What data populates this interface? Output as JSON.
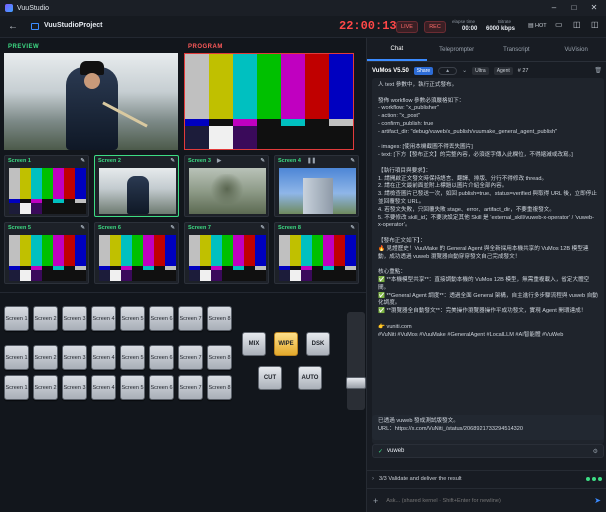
{
  "app": {
    "title": "VuuStudio"
  },
  "topbar": {
    "project": "VuuStudioProject",
    "timecode": "22:00:13",
    "live": "LIVE",
    "rec": "REC",
    "elapsed_label": "elapse time",
    "elapsed": "00:00",
    "bitrate_label": "Bitrate",
    "bitrate": "6000 kbps",
    "hot": "HOT"
  },
  "preview": {
    "label": "PREVIEW"
  },
  "program": {
    "label": "PROGRAM"
  },
  "screens": [
    {
      "label": "Screen 1"
    },
    {
      "label": "Screen 2"
    },
    {
      "label": "Screen 3"
    },
    {
      "label": "Screen 4"
    },
    {
      "label": "Screen 5"
    },
    {
      "label": "Screen 6"
    },
    {
      "label": "Screen 7"
    },
    {
      "label": "Screen 8"
    }
  ],
  "switcher": {
    "rows": [
      [
        "Screen 1",
        "Screen 2",
        "Screen 3",
        "Screen 4",
        "Screen 5",
        "Screen 6",
        "Screen 7",
        "Screen 8"
      ],
      [
        "Screen 1",
        "Screen 2",
        "Screen 3",
        "Screen 4",
        "Screen 5",
        "Screen 6",
        "Screen 7",
        "Screen 8"
      ],
      [
        "Screen 1",
        "Screen 2",
        "Screen 3",
        "Screen 4",
        "Screen 5",
        "Screen 6",
        "Screen 7",
        "Screen 8"
      ]
    ]
  },
  "transitions": {
    "mix": "MIX",
    "wipe": "WIPE",
    "dsk": "DSK",
    "cut": "CUT",
    "auto": "AUTO"
  },
  "colors": {
    "accent": "#3b8bff",
    "green": "#3ddc84",
    "red": "#e23b3b",
    "wipe": "#f2c14e"
  },
  "chat": {
    "tabs": [
      "Chat",
      "Teleprompter",
      "Transcript",
      "VuVision"
    ],
    "version": "VuMos V5.50",
    "share": "Share",
    "model": "Ultra",
    "mode": "Agent",
    "number": "# 27",
    "message": "人 text 參數中，執行正式發布。\n\n發佈 workflow 參數必須嚴格如下：\n- workflow: \"x_publisher\"\n- action: \"x_post\"\n- confirm_publish: true\n- artifact_dir: \"debug/vuweb/x_publish/vuumake_general_agent_publish\"\n\n- images: [使用本機截圖不得丟失圖片]\n- text: [下方【發布正文】的完整內容，必須逐字傳入此欄位，不得縮減或改寫。]\n\n【執行項目與要求】：\n1. 請開啟正文發文時保持語言、翻譯、排版、分行不得修改 thread。\n2. 請在正文最前面並附上標題以圖片介紹全部內容。\n3. 請檢查圖片已發送一次，如回 publish=true、status=verified 與取得 URL 後，立即停止並回覆發文 URL。\n4. 若發文失敗，只回覆失敗 stage、error、artifact_dir，不要重複發文。\n5. 不要修改 skill_id；不要決設定其他 Skill 是 ‘external_skill/vuweb-x-operator’ / ‘vuweb-x-operator’。\n\n【發布正文如下】：\n🔥 見證歷史！VuuMake 的 General Agent 與全新採用本機共享的 VuMos 12B 模型連動，成功透過 vuweb 瀏覽器自動穿穿發文自己完成發文！\n\n核心重點：\n✅ **本機模型共享**：直接調動本機的 VuMos 12B 模型，無需重複載入，省定大體空間。\n✅ **General Agent 調度**：透過全面 General 架構，自主進行多步驟流程與 vuweb 自動化調度。\n✅ **瀏覽器全自動發文**：完美操作瀏覽器操作平成功發文，實現 Agent 開環達成！\n\n👉 vuniti.com\n#VuNiti #VuMos #VuuMake #GeneralAgent #LocalLLM #AI智能體 #VuWeb",
    "reply_line1": "已透過 vuweb 發成測試版發文。",
    "reply_line2": "URL：https://x.com/VuNiti_/status/2068921733294514320",
    "tool": "vuweb",
    "step": "3/3  Validate and deliver the result",
    "input_placeholder": "Ask... (shared kernel · Shift+Enter for newline)"
  }
}
